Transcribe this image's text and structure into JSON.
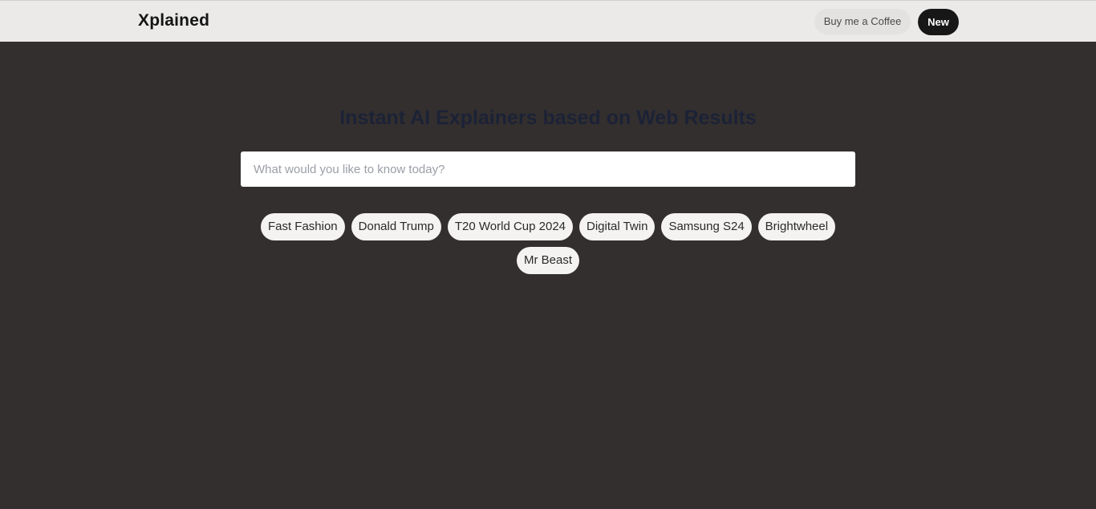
{
  "header": {
    "logo": "Xplained",
    "coffee_label": "Buy me a Coffee",
    "new_label": "New"
  },
  "main": {
    "headline": "Instant AI Explainers based on Web Results",
    "search_placeholder": "What would you like to know today?",
    "search_value": "",
    "suggestions": [
      "Fast Fashion",
      "Donald Trump",
      "T20 World Cup 2024",
      "Digital Twin",
      "Samsung S24",
      "Brightwheel",
      "Mr Beast"
    ]
  },
  "colors": {
    "page_background": "#332f2f",
    "header_background": "#ebeae9",
    "new_button": "#171717",
    "headline": "#1c2236",
    "chip_background": "#f4f3f2"
  }
}
